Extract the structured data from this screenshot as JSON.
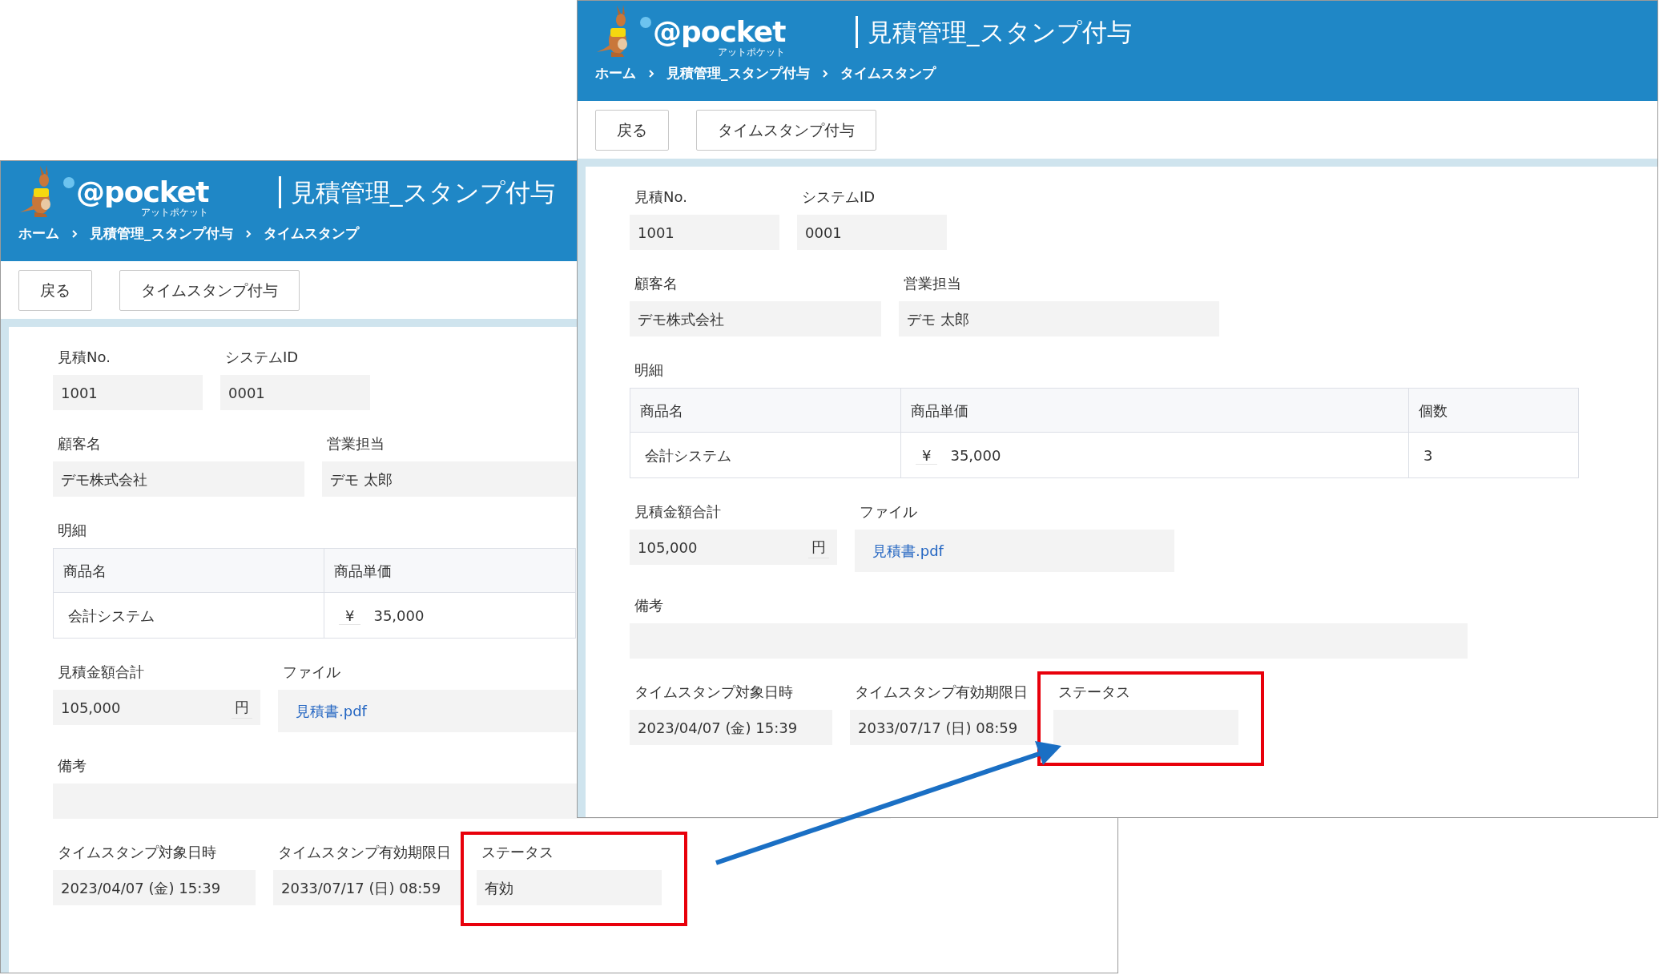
{
  "windows": [
    {
      "brand": "@pocket",
      "brand_sub": "アットポケット",
      "title": "見積管理_スタンプ付与",
      "breadcrumb": [
        "ホーム",
        "見積管理_スタンプ付与",
        "タイムスタンプ"
      ],
      "toolbar_buttons": [
        "戻る",
        "タイムスタンプ付与"
      ],
      "sections": [
        {
          "kind": "fields",
          "fields": [
            {
              "label": "見積No.",
              "value": "1001"
            },
            {
              "label": "システムID",
              "value": "0001"
            }
          ]
        },
        {
          "kind": "fields",
          "fields": [
            {
              "label": "顧客名",
              "value": "デモ株式会社"
            },
            {
              "label": "営業担当",
              "value": "デモ 太郎"
            }
          ]
        },
        {
          "kind": "table",
          "label": "明細",
          "columns": [
            "商品名",
            "商品単価"
          ],
          "rows": [
            [
              {
                "text": "会計システム"
              },
              {
                "currency": "¥",
                "amount": "35,000"
              }
            ]
          ]
        },
        {
          "kind": "fields",
          "fields": [
            {
              "label": "見積金額合計",
              "value": "105,000",
              "unit": "円"
            },
            {
              "label": "ファイル",
              "link": "見積書.pdf"
            }
          ]
        },
        {
          "kind": "fields",
          "fields": [
            {
              "label": "備考"
            }
          ]
        },
        {
          "kind": "fields",
          "fields": [
            {
              "label": "タイムスタンプ対象日時",
              "value": "2023/04/07 (金) 15:39"
            },
            {
              "label": "タイムスタンプ有効期限日",
              "value": "2033/07/17 (日) 08:59"
            },
            {
              "label": "ステータス",
              "value": "有効",
              "highlighted": true
            }
          ]
        }
      ]
    },
    {
      "brand": "@pocket",
      "brand_sub": "アットポケット",
      "title": "見積管理_スタンプ付与",
      "breadcrumb": [
        "ホーム",
        "見積管理_スタンプ付与",
        "タイムスタンプ"
      ],
      "toolbar_buttons": [
        "戻る",
        "タイムスタンプ付与"
      ],
      "sections": [
        {
          "kind": "fields",
          "fields": [
            {
              "label": "見積No.",
              "value": "1001"
            },
            {
              "label": "システムID",
              "value": "0001"
            }
          ]
        },
        {
          "kind": "fields",
          "fields": [
            {
              "label": "顧客名",
              "value": "デモ株式会社"
            },
            {
              "label": "営業担当",
              "value": "デモ 太郎"
            }
          ]
        },
        {
          "kind": "table",
          "label": "明細",
          "columns": [
            "商品名",
            "商品単価",
            "個数"
          ],
          "rows": [
            [
              {
                "text": "会計システム"
              },
              {
                "currency": "¥",
                "amount": "35,000"
              },
              {
                "text": "3"
              }
            ]
          ]
        },
        {
          "kind": "fields",
          "fields": [
            {
              "label": "見積金額合計",
              "value": "105,000",
              "unit": "円"
            },
            {
              "label": "ファイル",
              "link": "見積書.pdf"
            }
          ]
        },
        {
          "kind": "fields",
          "fields": [
            {
              "label": "備考"
            }
          ]
        },
        {
          "kind": "fields",
          "fields": [
            {
              "label": "タイムスタンプ対象日時",
              "value": "2023/04/07 (金) 15:39"
            },
            {
              "label": "タイムスタンプ有効期限日",
              "value": "2033/07/17 (日) 08:59"
            },
            {
              "label": "ステータス",
              "highlighted": true
            }
          ]
        }
      ]
    }
  ],
  "callout_arrow": true
}
